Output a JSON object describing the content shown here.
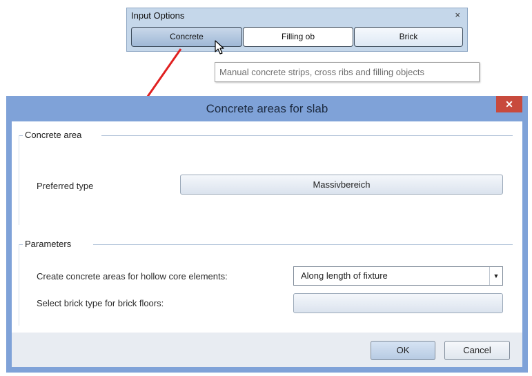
{
  "input_options": {
    "title": "Input Options",
    "close_glyph": "×",
    "buttons": [
      "Concrete",
      "Filling ob",
      "Brick"
    ],
    "active_index": 0,
    "tooltip": "Manual concrete strips, cross ribs and filling objects"
  },
  "dialog": {
    "title": "Concrete areas for slab",
    "close_glyph": "✕",
    "concrete_area": {
      "legend": "Concrete area",
      "preferred_type_label": "Preferred type",
      "preferred_type_value": "Massivbereich"
    },
    "parameters": {
      "legend": "Parameters",
      "hollow_core_label": "Create concrete areas for hollow core elements:",
      "hollow_core_value": "Along length of fixture",
      "brick_label": "Select brick type for brick floors:",
      "brick_value": ""
    },
    "footer": {
      "ok": "OK",
      "cancel": "Cancel"
    }
  },
  "colors": {
    "dialog_frame": "#7fa2d8",
    "close_button": "#c84a3d",
    "annotation_arrow": "#e02020"
  },
  "icons": [
    "pointer-cursor-icon",
    "dropdown-arrow-icon",
    "close-icon"
  ]
}
